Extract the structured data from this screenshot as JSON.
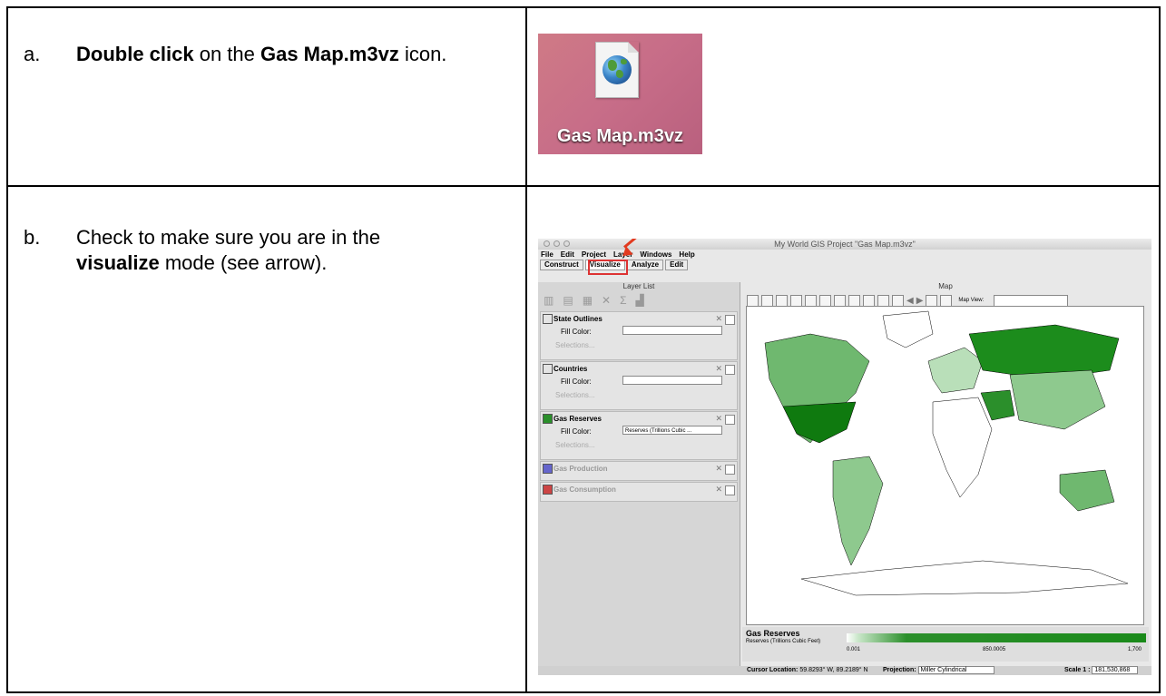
{
  "steps": [
    {
      "letter": "a.",
      "pre": "Double click",
      "mid": " on the ",
      "bold2": "Gas Map.m3vz",
      "post": " icon."
    },
    {
      "letter": "b.",
      "pre": "Check to make sure you are in the ",
      "bold": "visualize",
      "post": " mode (see arrow)."
    }
  ],
  "desktop_icon": {
    "label": "Gas Map.m3vz",
    "icon": "globe-document-icon"
  },
  "app": {
    "title": "My World GIS Project \"Gas Map.m3vz\"",
    "menu": [
      "File",
      "Edit",
      "Project",
      "Layer",
      "Windows",
      "Help"
    ],
    "tabs": [
      "Construct",
      "Visualize",
      "Analyze",
      "Edit"
    ],
    "active_tab": "Visualize",
    "layer_list_title": "Layer List",
    "map_title": "Map",
    "map_view_label": "Map View:",
    "layers": [
      {
        "name": "State Outlines",
        "fill_label": "Fill Color:",
        "fill_value": "",
        "selections": "Selections..."
      },
      {
        "name": "Countries",
        "fill_label": "Fill Color:",
        "fill_value": "",
        "selections": "Selections..."
      },
      {
        "name": "Gas Reserves",
        "fill_label": "Fill Color:",
        "fill_value": "Reserves (Trillions Cubic ...",
        "selections": "Selections..."
      },
      {
        "name": "Gas Production"
      },
      {
        "name": "Gas Consumption"
      }
    ],
    "legend": {
      "title": "Gas Reserves",
      "subtitle": "Reserves (Trillions Cubic Feet)",
      "min": "0.001",
      "mid": "850.0005",
      "max": "1,700"
    },
    "status": {
      "cursor_label": "Cursor Location:",
      "cursor_value": "59.8293° W, 89.2189° N",
      "projection_label": "Projection:",
      "projection_value": "Miller Cylindrical",
      "scale_label": "Scale 1 :",
      "scale_value": "181,530,868"
    },
    "colors": {
      "highlight": "#d33333",
      "arrow": "#e23a1f",
      "map_green": "#2b8f2b"
    }
  }
}
